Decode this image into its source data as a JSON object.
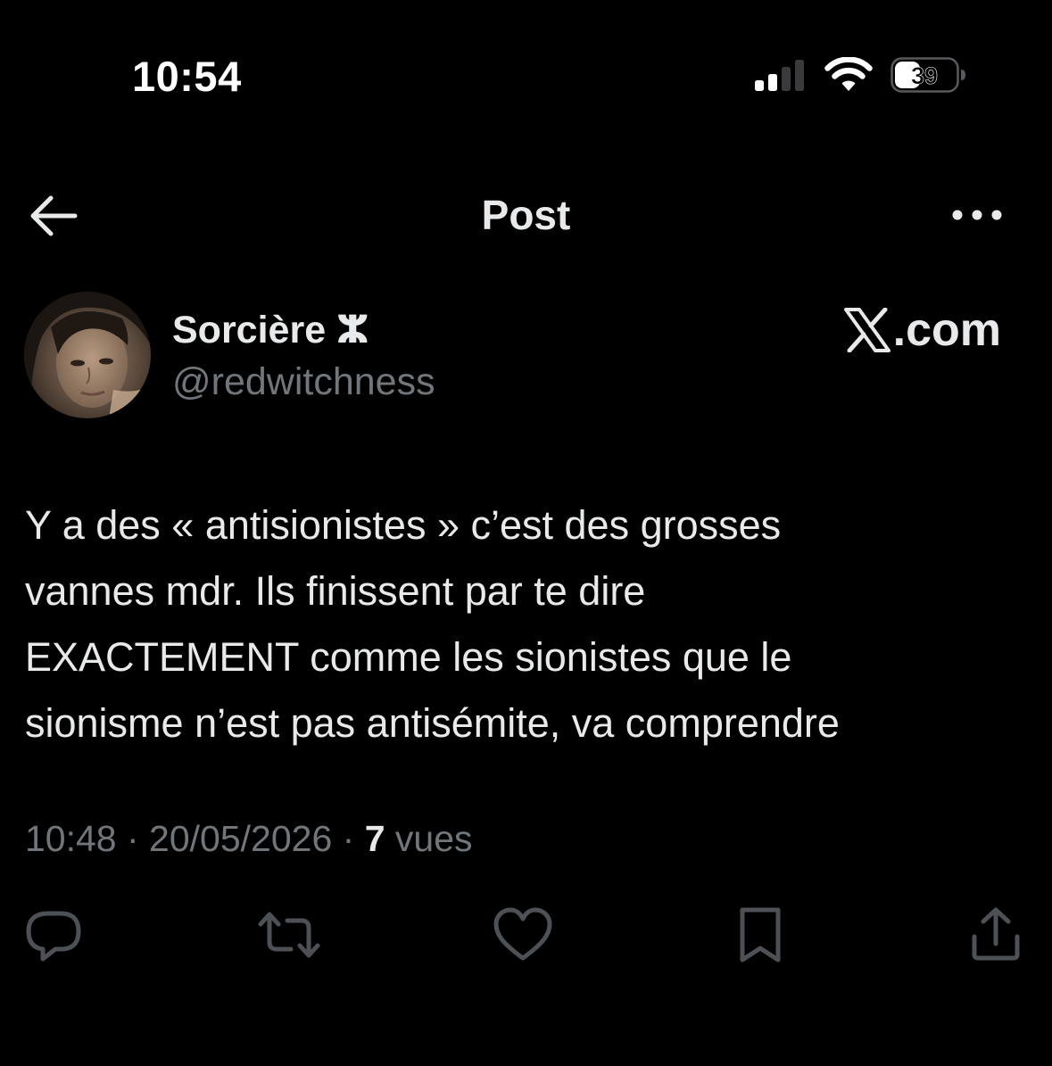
{
  "status_bar": {
    "time": "10:54",
    "battery_level": "39"
  },
  "header": {
    "title": "Post",
    "back_icon": "arrow-left-icon",
    "more_icon": "more-horizontal-icon"
  },
  "post": {
    "author": {
      "name": "Sorcière ⵣ",
      "handle": "@redwitchness"
    },
    "brand": {
      "logo_icon": "x-logo-icon",
      "suffix": ".com"
    },
    "text_lines": [
      "Y a des « antisionistes » c’est des grosses",
      "vannes mdr. Ils finissent par te dire",
      "EXACTEMENT comme les sionistes que le",
      "sionisme n’est pas antisémite, va comprendre"
    ],
    "meta": {
      "time": "10:48",
      "date": "20/05/2026",
      "separator": " · ",
      "views_count": "7",
      "views_label": "vues"
    }
  },
  "actions": [
    {
      "name": "reply",
      "icon": "reply-icon"
    },
    {
      "name": "repost",
      "icon": "repost-icon"
    },
    {
      "name": "like",
      "icon": "heart-icon"
    },
    {
      "name": "bookmark",
      "icon": "bookmark-icon"
    },
    {
      "name": "share",
      "icon": "share-icon"
    }
  ],
  "colors": {
    "background": "#000000",
    "text_primary": "#e7e9ea",
    "text_secondary": "#71767b"
  }
}
